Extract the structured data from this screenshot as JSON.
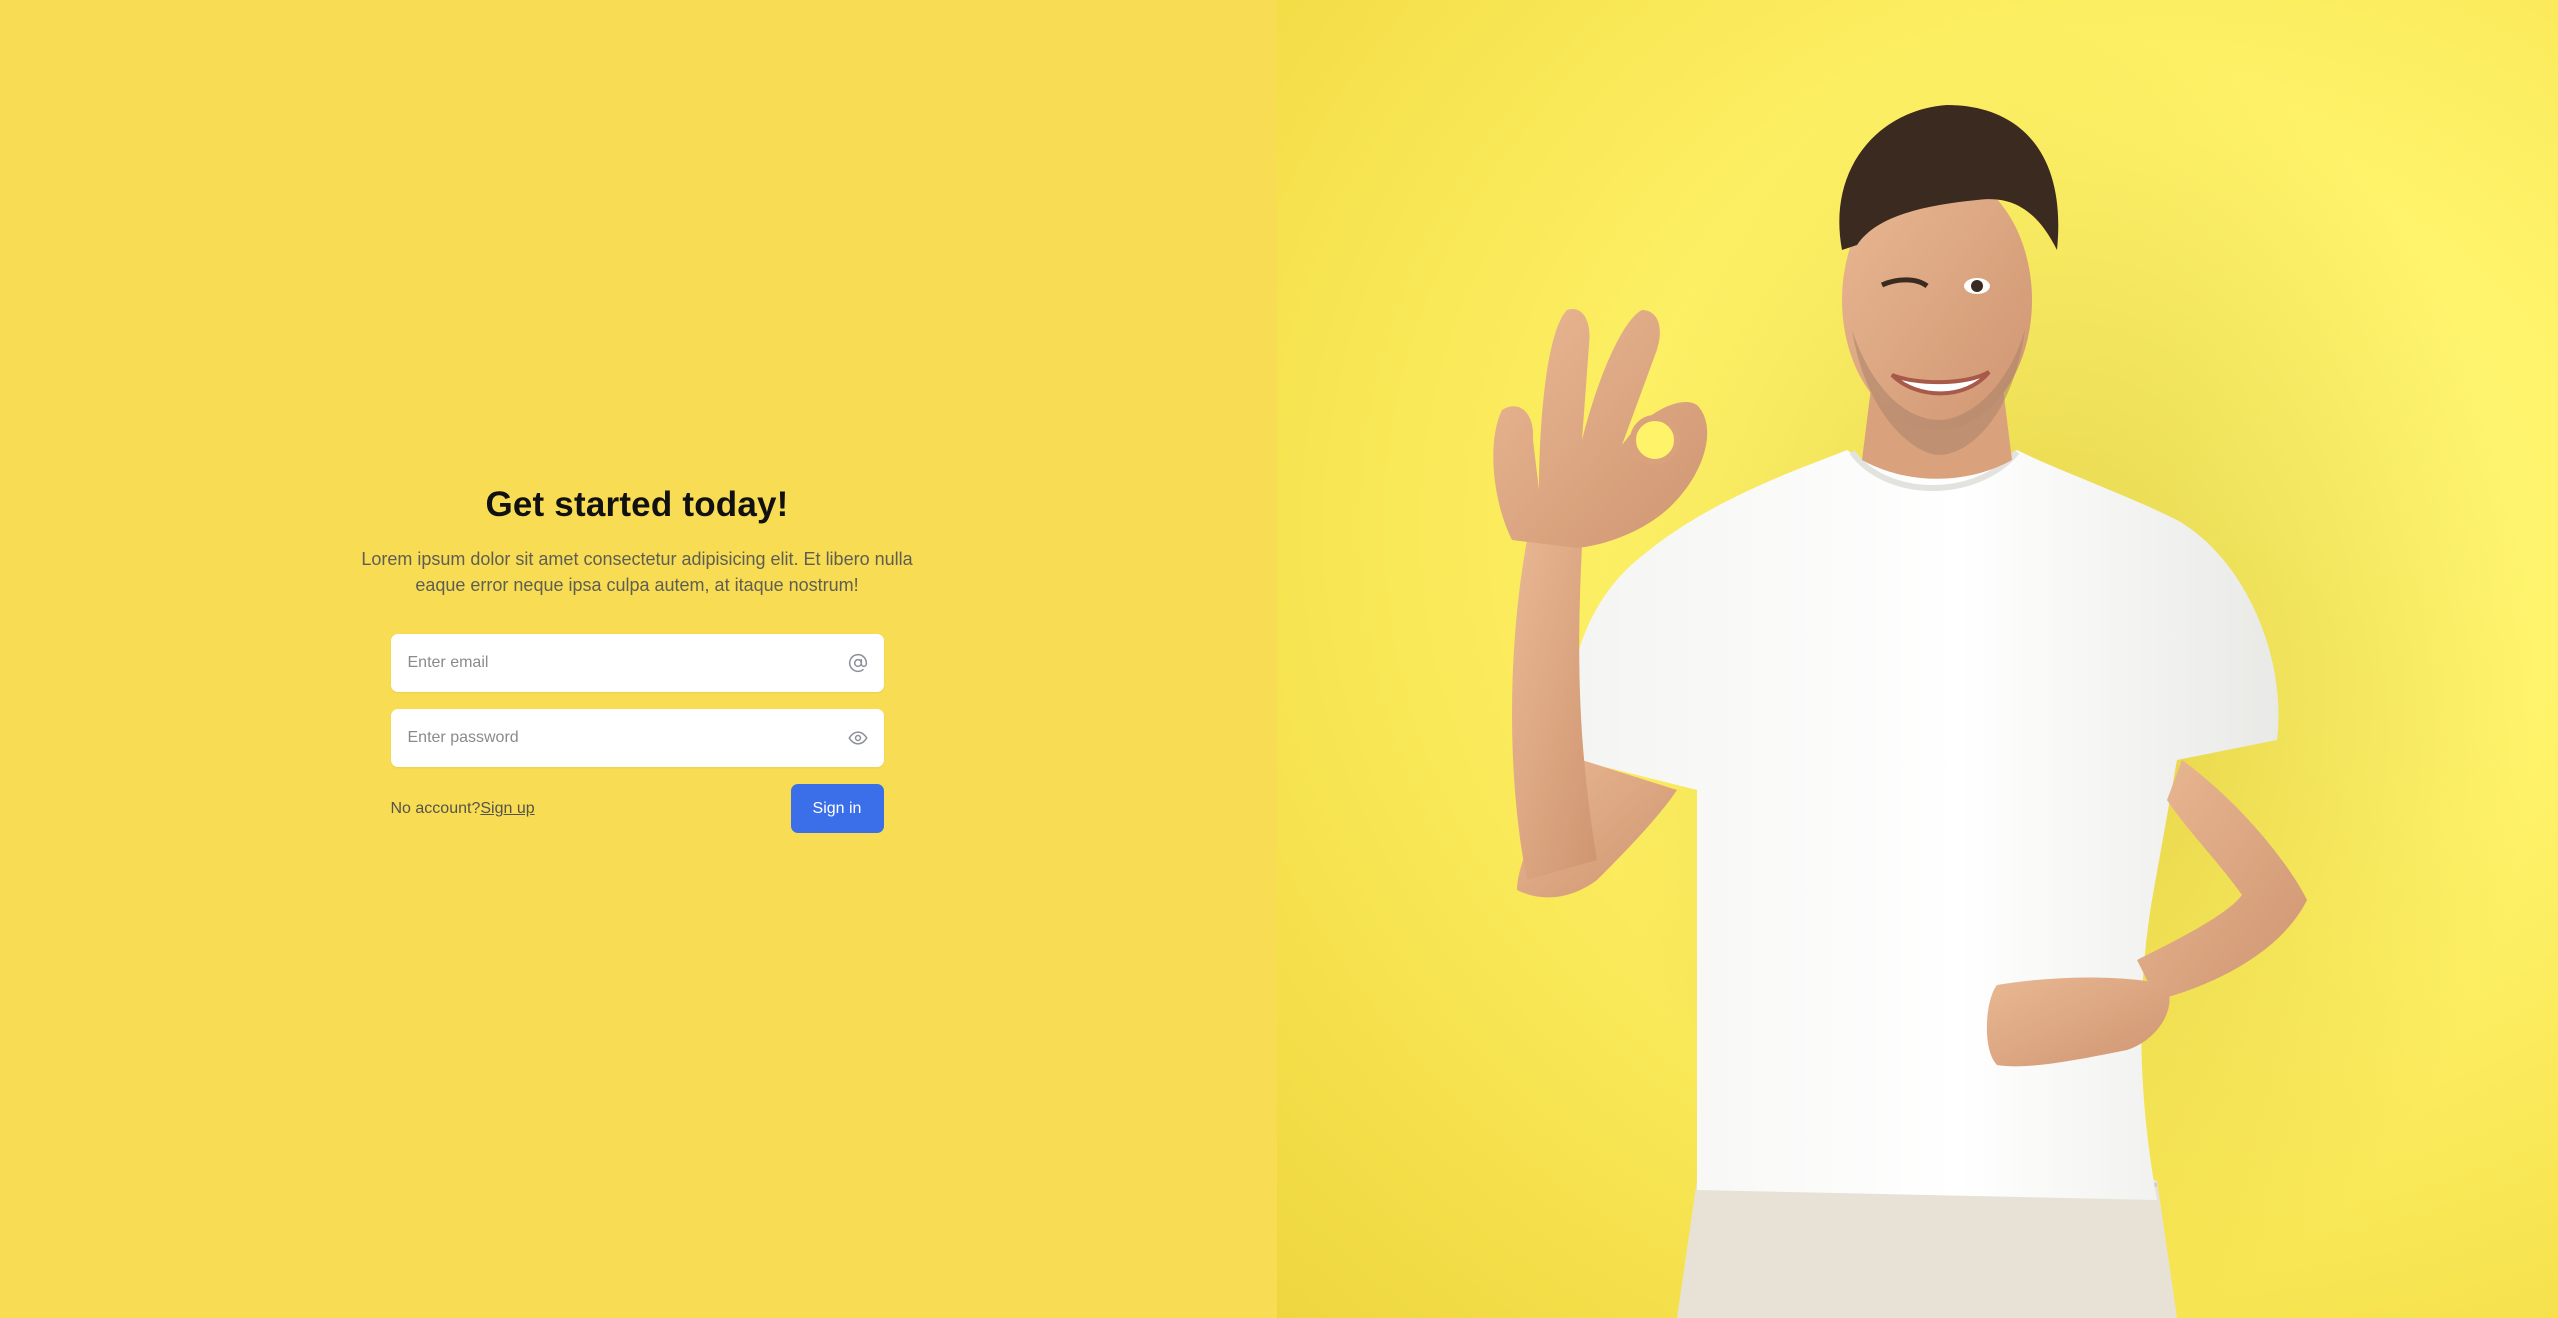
{
  "hero": {
    "title": "Get started today!",
    "subtitle": "Lorem ipsum dolor sit amet consectetur adipisicing elit. Et libero nulla eaque error neque ipsa culpa autem, at itaque nostrum!"
  },
  "form": {
    "email": {
      "placeholder": "Enter email",
      "value": "",
      "icon": "at-sign-icon"
    },
    "password": {
      "placeholder": "Enter password",
      "value": "",
      "icon": "eye-icon"
    },
    "no_account_text": "No account?",
    "signup_label": "Sign up",
    "signin_label": "Sign in"
  },
  "colors": {
    "left_background": "#f8dc54",
    "right_background": "#fff36a",
    "button_blue": "#3b6fe9",
    "title_text": "#111111",
    "body_text": "#5f5e52"
  }
}
